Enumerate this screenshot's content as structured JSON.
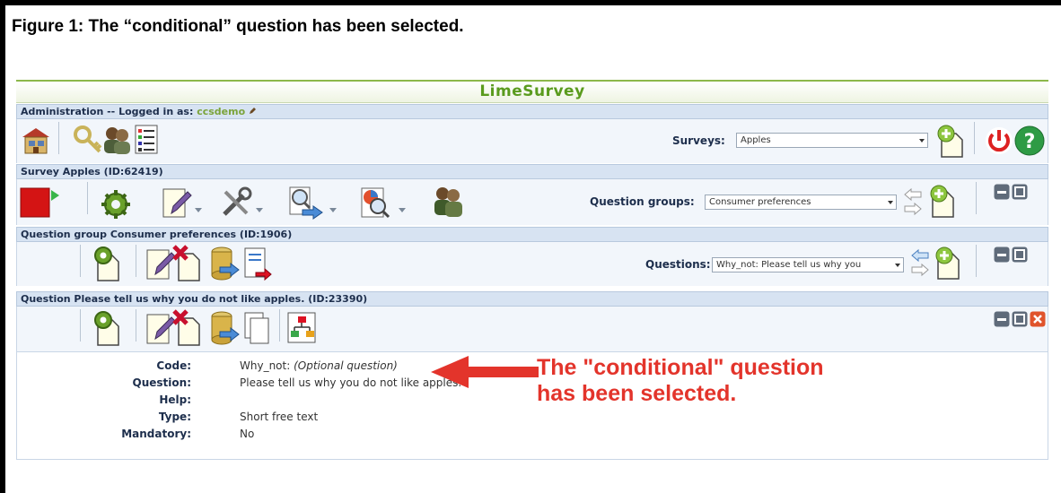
{
  "figure_caption": "Figure 1:  The “conditional” question has been selected.",
  "app": {
    "title": "LimeSurvey"
  },
  "admin": {
    "label": "Administration -- Logged in as:",
    "user": "ccsdemo",
    "surveys_label": "Surveys:",
    "surveys_selected": "Apples",
    "icons": [
      "home-icon",
      "keys-icon",
      "users-icon",
      "list-icon",
      "add-survey-icon",
      "logout-icon",
      "help-icon"
    ]
  },
  "survey": {
    "label": "Survey Apples (ID:62419)",
    "groups_label": "Question groups:",
    "groups_selected": "Consumer preferences"
  },
  "group": {
    "label": "Question group Consumer preferences (ID:1906)",
    "questions_label": "Questions:",
    "questions_selected": "Why_not: Please tell us why you"
  },
  "question": {
    "label": "Question Please tell us why you do not like apples. (ID:23390)"
  },
  "details": {
    "code_key": "Code:",
    "code_value": "Why_not:",
    "code_note": "(Optional question)",
    "question_key": "Question:",
    "question_value": "Please tell us why you do not like apples.",
    "help_key": "Help:",
    "help_value": "",
    "type_key": "Type:",
    "type_value": "Short free text",
    "mandatory_key": "Mandatory:",
    "mandatory_value": "No"
  },
  "annotation": {
    "text": "The \"conditional\" question has been selected.",
    "color": "#e3342b"
  },
  "colors": {
    "brand": "#5a9b1e",
    "bar": "#d7e3f2",
    "toolbar": "#f2f6fb"
  }
}
